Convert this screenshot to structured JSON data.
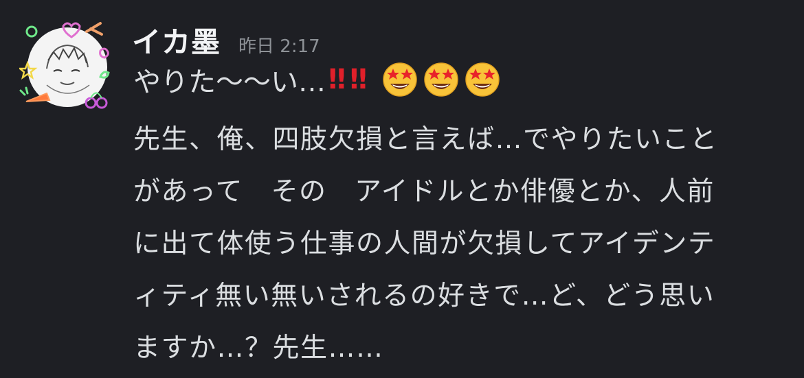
{
  "message": {
    "username": "イカ墨",
    "timestamp": "昨日 2:17",
    "first_line_text": "やりた〜〜い…",
    "bang_glyph": "‼",
    "bang_count": 2,
    "emoji": "star-struck-face",
    "emoji_count": 3,
    "body_lines": [
      "先生、俺、四肢欠損と言えば…でやりたいこと",
      "があって　その　アイドルとか俳優とか、人前",
      "に出て体使う仕事の人間が欠損してアイデンテ",
      "ィティ無い無いされるの好きで…ど、どう思い",
      "ますか…？先生……"
    ]
  },
  "colors": {
    "background": "#1e1f24",
    "username": "#f2f3f5",
    "timestamp": "#8e9297",
    "text": "#dbdee1",
    "bang": "#e0202a"
  }
}
